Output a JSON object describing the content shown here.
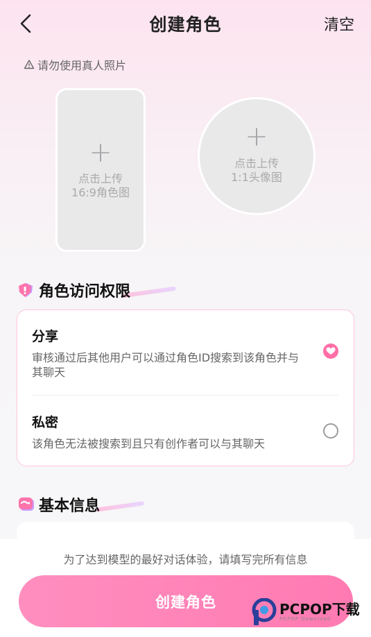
{
  "header": {
    "title": "创建角色",
    "clear_label": "清空"
  },
  "warning_text": "请勿使用真人照片",
  "uploads": {
    "cover": {
      "line1": "点击上传",
      "line2": "16:9角色图"
    },
    "avatar": {
      "line1": "点击上传",
      "line2": "1:1头像图"
    }
  },
  "access_section": {
    "title": "角色访问权限",
    "options": [
      {
        "title": "分享",
        "desc": "审核通过后其他用户可以通过角色ID搜索到该角色并与其聊天",
        "selected": true
      },
      {
        "title": "私密",
        "desc": "该角色无法被搜索到且只有创作者可以与其聊天",
        "selected": false
      }
    ]
  },
  "basic_section": {
    "title": "基本信息"
  },
  "footer": {
    "hint": "为了达到模型的最好对话体验，请填写完所有信息",
    "create_label": "创建角色"
  },
  "watermark": {
    "brand": "PCPOP下载",
    "sub": "PCPOP Download"
  },
  "colors": {
    "accent": "#ff7ab2",
    "card_border": "#ffc5de"
  }
}
